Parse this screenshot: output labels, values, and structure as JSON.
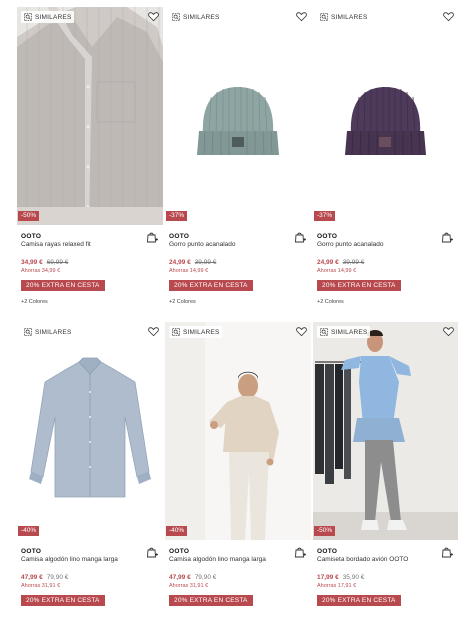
{
  "products": [
    {
      "similar_label": "SIMILARES",
      "discount": "-50%",
      "brand": "OOTO",
      "name": "Camisa rayas relaxed fit",
      "price": "34,99 €",
      "old_price": "69,99 €",
      "savings": "Ahorras 34,99 €",
      "promo": "20% EXTRA EN CESTA",
      "colors": "+2 Colores",
      "image": "striped-shirt-photo"
    },
    {
      "similar_label": "SIMILARES",
      "discount": "-37%",
      "brand": "OOTO",
      "name": "Gorro punto acanalado",
      "price": "24,99 €",
      "old_price": "39,99 €",
      "savings": "Ahorras 14,99 €",
      "promo": "20% EXTRA EN CESTA",
      "colors": "+2 Colores",
      "image": "teal-beanie-photo"
    },
    {
      "similar_label": "SIMILARES",
      "discount": "-37%",
      "brand": "OOTO",
      "name": "Gorro punto acanalado",
      "price": "24,99 €",
      "old_price": "39,99 €",
      "savings": "Ahorras 14,99 €",
      "promo": "20% EXTRA EN CESTA",
      "colors": "+2 Colores",
      "image": "purple-beanie-photo"
    },
    {
      "similar_label": "SIMILARES",
      "discount": "-40%",
      "brand": "OOTO",
      "name": "Camisa algodón lino manga larga",
      "price": "47,99 €",
      "old_price": "79,90 €",
      "savings": "Ahorras 31,91 €",
      "promo": "20% EXTRA EN CESTA",
      "image": "blue-shirt-photo"
    },
    {
      "similar_label": "SIMILARES",
      "discount": "-40%",
      "brand": "OOTO",
      "name": "Camisa algodón lino manga larga",
      "price": "47,99 €",
      "old_price": "79,90 €",
      "savings": "Ahorras 31,91 €",
      "promo": "20% EXTRA EN CESTA",
      "image": "beige-shirt-model-photo"
    },
    {
      "similar_label": "SIMILARES",
      "discount": "-50%",
      "brand": "OOTO",
      "name": "Camiseta bordado avión OOTO",
      "price": "17,99 €",
      "old_price": "35,90 €",
      "savings": "Ahorras 17,91 €",
      "promo": "20% EXTRA EN CESTA",
      "image": "blue-tshirt-model-photo"
    }
  ],
  "colors": {
    "accent": "#b84a4f",
    "text": "#222222"
  },
  "icons": {
    "similar": "similar-search-icon",
    "favorite": "heart-icon",
    "bag": "add-to-bag-icon"
  }
}
